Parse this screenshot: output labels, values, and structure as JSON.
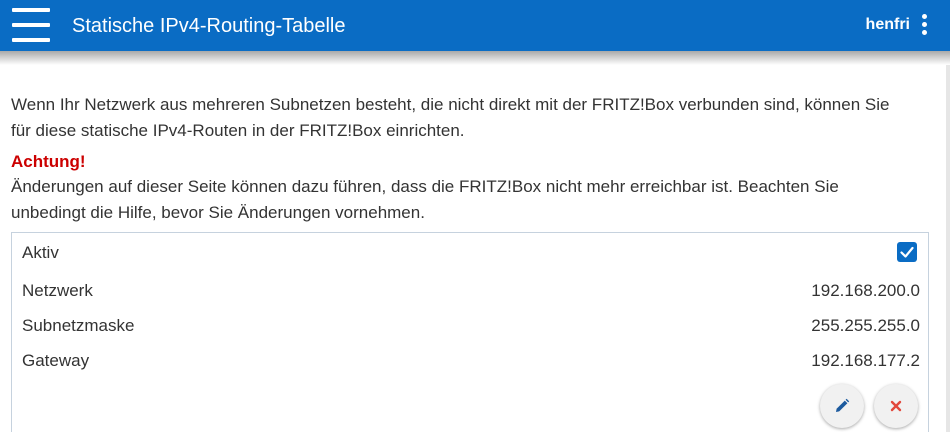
{
  "header": {
    "title": "Statische IPv4-Routing-Tabelle",
    "user": "henfri",
    "menu_icon": "hamburger-menu-icon",
    "more_icon": "kebab-menu-icon"
  },
  "intro": "Wenn Ihr Netzwerk aus mehreren Subnetzen besteht, die nicht direkt mit der FRITZ!Box verbunden sind, können Sie für diese statische IPv4-Routen in der FRITZ!Box einrichten.",
  "warning": {
    "title": "Achtung!",
    "text": "Änderungen auf dieser Seite können dazu führen, dass die FRITZ!Box nicht mehr erreichbar ist. Beachten Sie unbedingt die Hilfe, bevor Sie Änderungen vornehmen."
  },
  "route": {
    "active_label": "Aktiv",
    "active": true,
    "network_label": "Netzwerk",
    "network": "192.168.200.0",
    "subnet_label": "Subnetzmaske",
    "subnet": "255.255.255.0",
    "gateway_label": "Gateway",
    "gateway": "192.168.177.2",
    "edit_icon": "pencil-icon",
    "delete_icon": "close-icon"
  },
  "colors": {
    "header": "#0a6cc4",
    "warning": "#cc0000",
    "checkbox": "#0a6cc4",
    "edit_icon": "#1c5a9e",
    "delete_icon": "#e2473b"
  }
}
